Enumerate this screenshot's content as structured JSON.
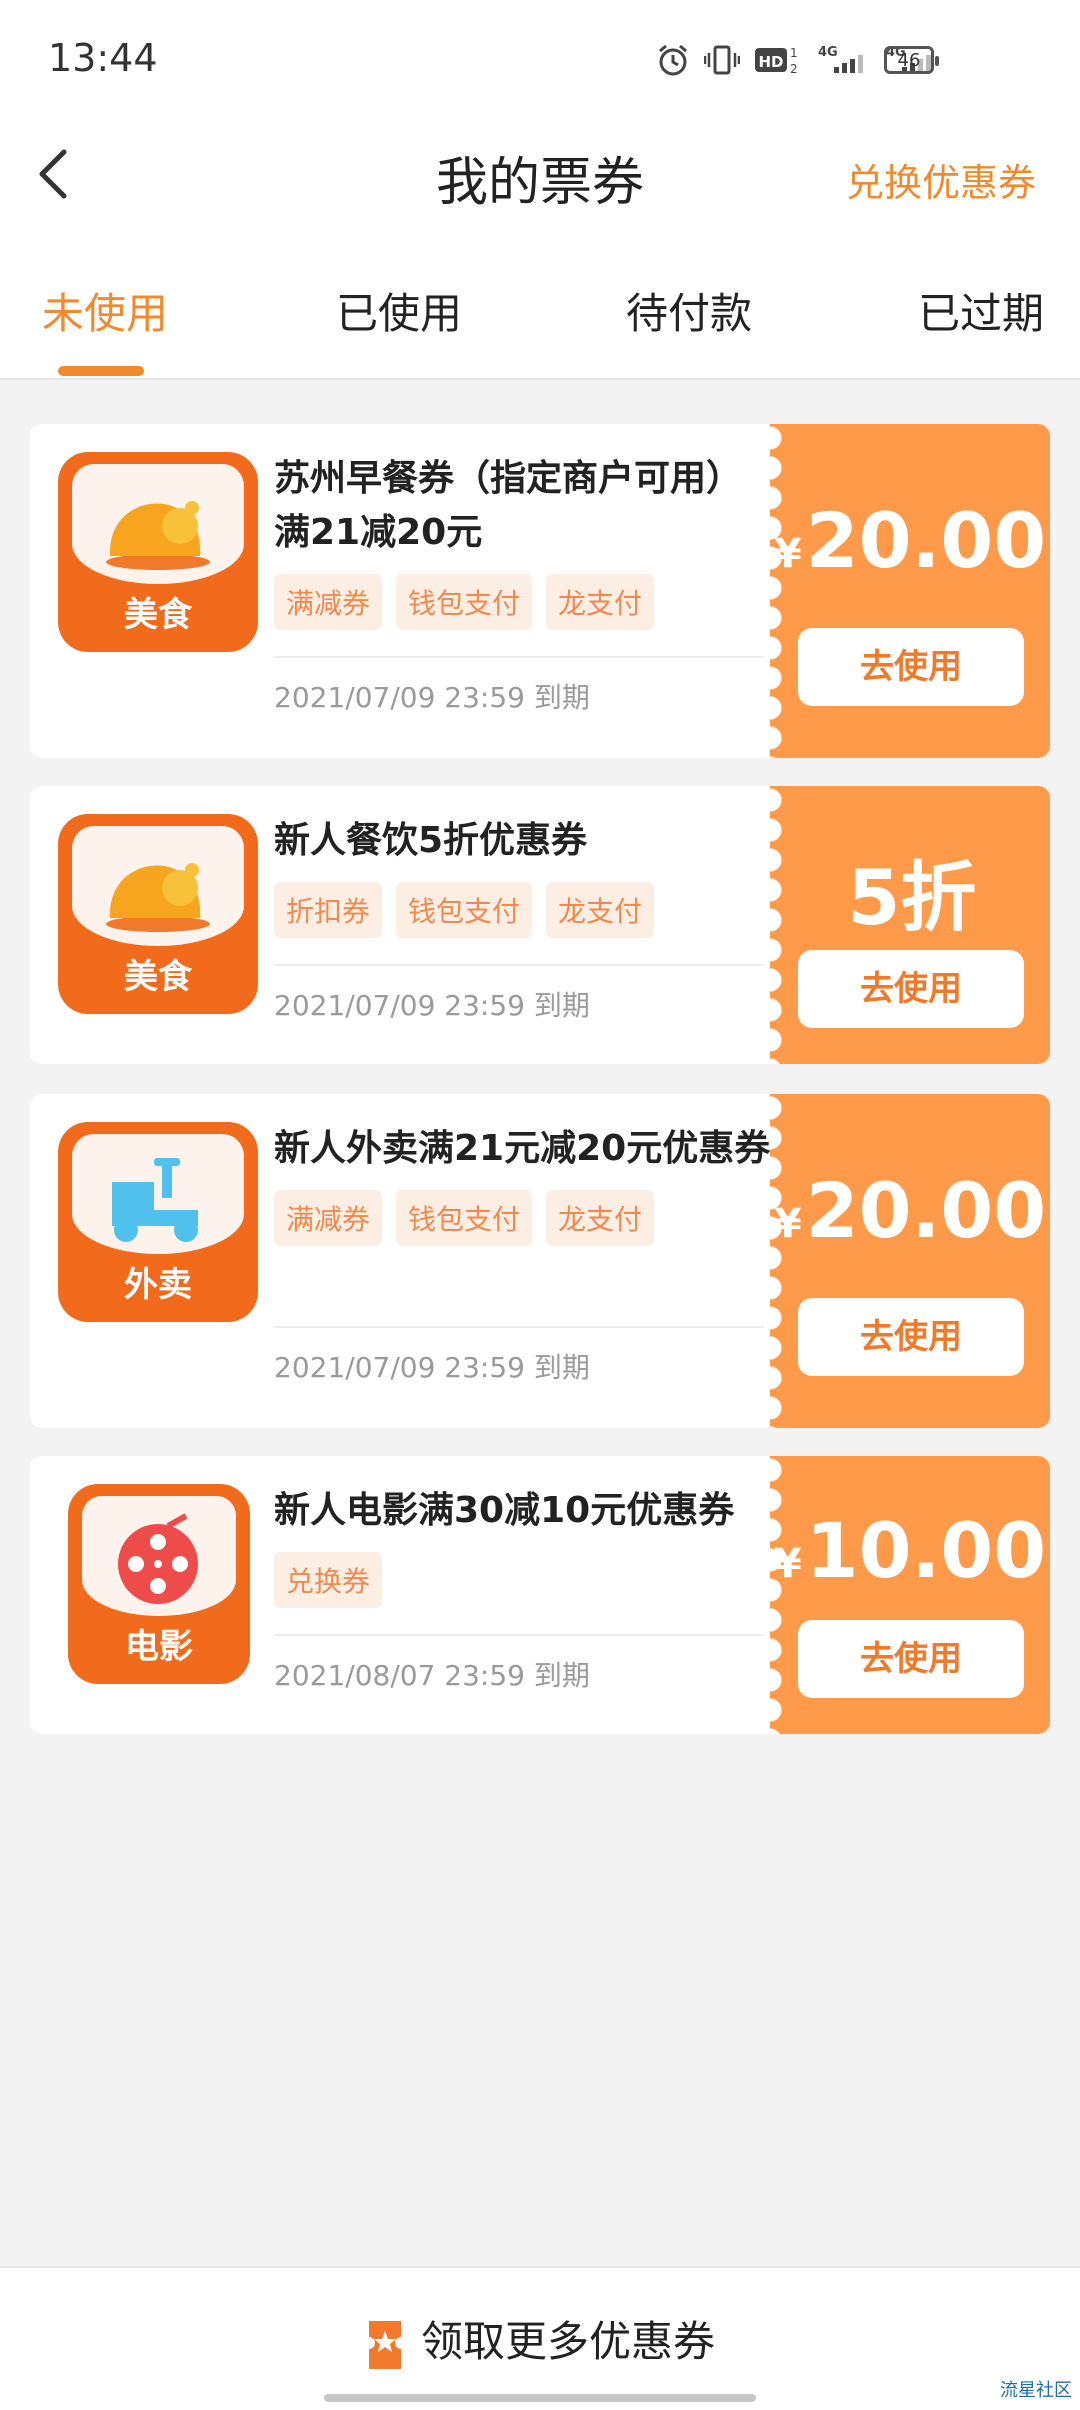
{
  "status": {
    "time": "13:44",
    "battery": "46"
  },
  "header": {
    "title": "我的票券",
    "exchange_label": "兑换优惠券"
  },
  "tabs": [
    {
      "label": "未使用",
      "active": true
    },
    {
      "label": "已使用"
    },
    {
      "label": "待付款"
    },
    {
      "label": "已过期"
    }
  ],
  "coupons": [
    {
      "category": "美食",
      "icon": "roast-chicken-icon",
      "title": "苏州早餐券（指定商户可用）满21减20元",
      "tags": [
        "满减券",
        "钱包支付",
        "龙支付"
      ],
      "expire": "2021/07/09 23:59 到期",
      "currency": "¥",
      "amount": "20.00",
      "action": "去使用"
    },
    {
      "category": "美食",
      "icon": "roast-chicken-icon",
      "title": "新人餐饮5折优惠券",
      "tags": [
        "折扣券",
        "钱包支付",
        "龙支付"
      ],
      "expire": "2021/07/09 23:59 到期",
      "currency": "",
      "amount": "5折",
      "action": "去使用"
    },
    {
      "category": "外卖",
      "icon": "scooter-icon",
      "title": "新人外卖满21元减20元优惠券",
      "tags": [
        "满减券",
        "钱包支付",
        "龙支付"
      ],
      "expire": "2021/07/09 23:59 到期",
      "currency": "¥",
      "amount": "20.00",
      "action": "去使用"
    },
    {
      "category": "电影",
      "icon": "film-reel-icon",
      "title": "新人电影满30减10元优惠券",
      "tags": [
        "兑换券"
      ],
      "expire": "2021/08/07 23:59 到期",
      "currency": "¥",
      "amount": "10.00",
      "action": "去使用"
    }
  ],
  "bottom": {
    "label": "领取更多优惠券"
  },
  "watermark": "流星社区",
  "colors": {
    "accent": "#f08a2c",
    "coupon_right": "#ff9a4a",
    "icon_bg": "#f26a1b"
  }
}
